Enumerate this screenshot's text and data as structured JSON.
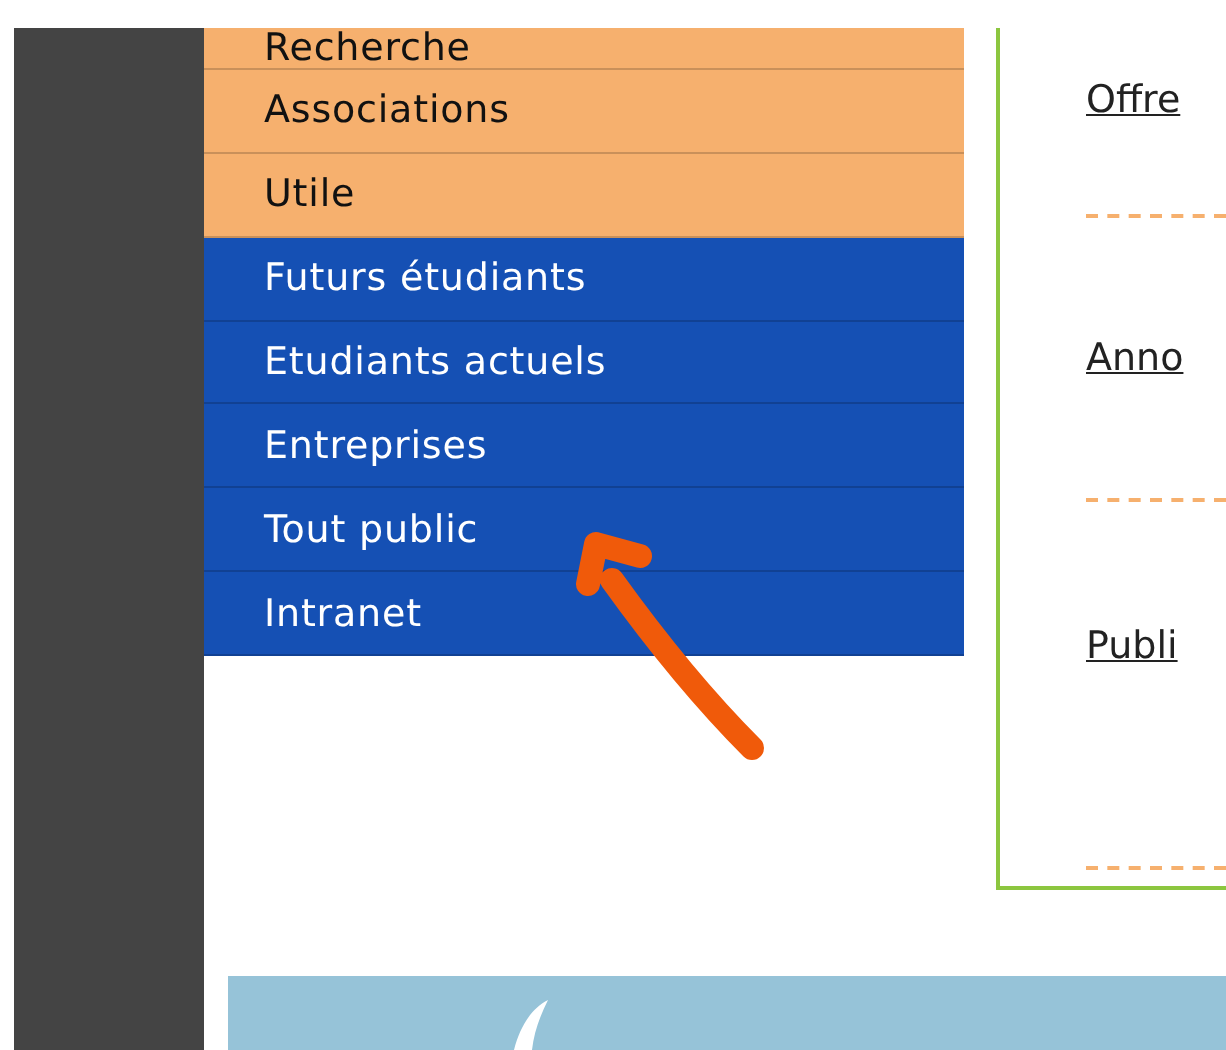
{
  "menu": [
    {
      "label": "Recherche",
      "color": "#f6b06e"
    },
    {
      "label": "Associations",
      "color": "#f6b06e"
    },
    {
      "label": "Utile",
      "color": "#f6b06e"
    },
    {
      "label": "Futurs étudiants",
      "color": "#1550b4"
    },
    {
      "label": "Etudiants actuels",
      "color": "#1550b4"
    },
    {
      "label": "Entreprises",
      "color": "#1550b4"
    },
    {
      "label": "Tout public",
      "color": "#1550b4"
    },
    {
      "label": "Intranet",
      "color": "#1550b4"
    }
  ],
  "links": [
    "Offre",
    "Anno",
    "Publi"
  ]
}
